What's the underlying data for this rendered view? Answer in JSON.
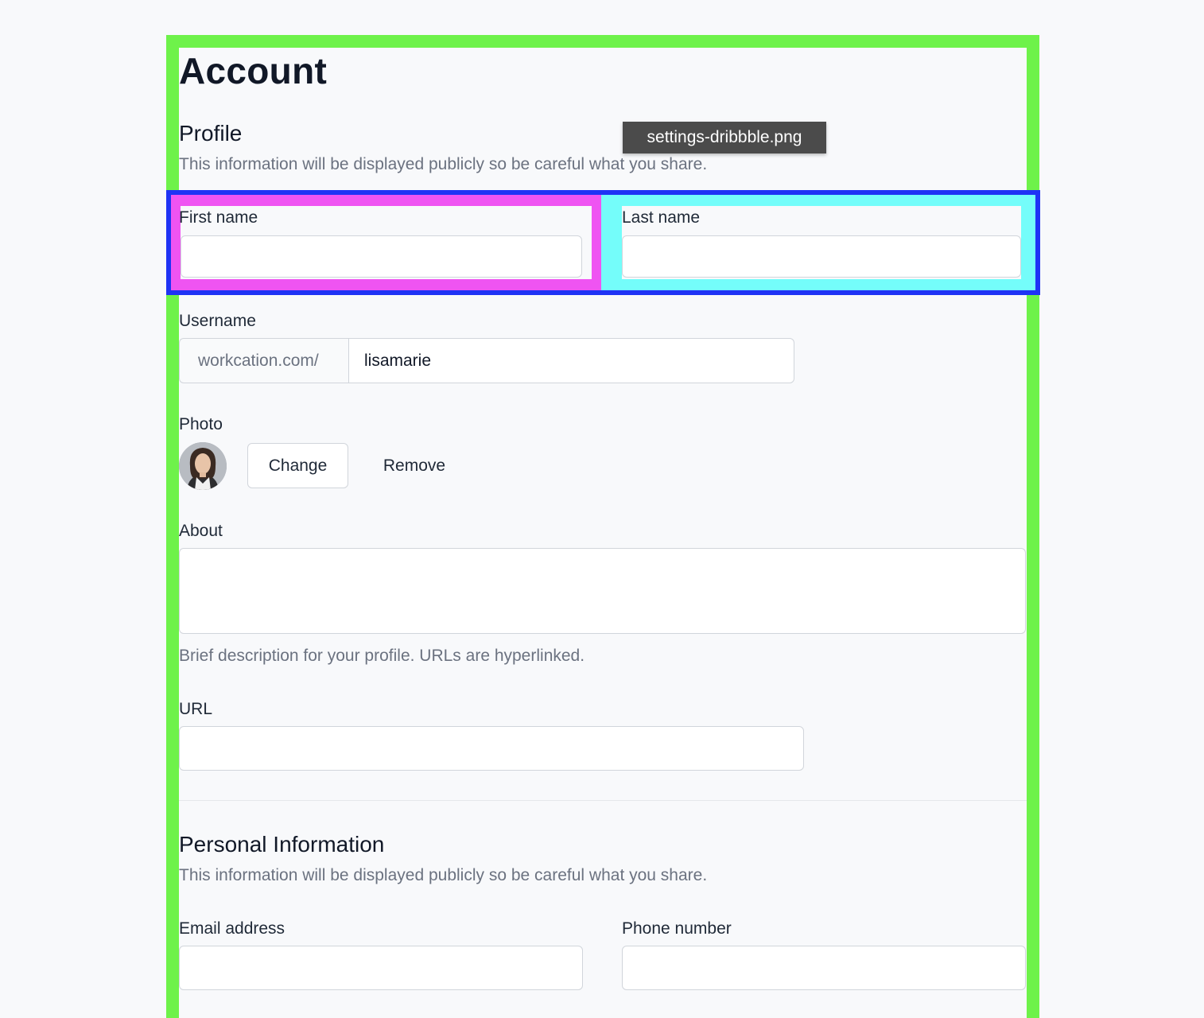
{
  "page": {
    "title": "Account"
  },
  "tooltip": {
    "text": "settings-dribbble.png"
  },
  "profile": {
    "title": "Profile",
    "description": "This information will be displayed publicly so be careful what you share.",
    "first_name": {
      "label": "First name",
      "value": ""
    },
    "last_name": {
      "label": "Last name",
      "value": ""
    },
    "username": {
      "label": "Username",
      "prefix": "workcation.com/",
      "value": "lisamarie"
    },
    "photo": {
      "label": "Photo",
      "change_label": "Change",
      "remove_label": "Remove"
    },
    "about": {
      "label": "About",
      "value": "",
      "help": "Brief description for your profile. URLs are hyperlinked."
    },
    "url": {
      "label": "URL",
      "value": ""
    }
  },
  "personal": {
    "title": "Personal Information",
    "description": "This information will be displayed publicly so be careful what you share.",
    "email": {
      "label": "Email address",
      "value": ""
    },
    "phone": {
      "label": "Phone number",
      "value": ""
    }
  },
  "colors": {
    "green_frame": "#6ef24a",
    "blue_frame": "#1f33f5",
    "magenta_frame": "#ef54f2",
    "cyan_frame": "#74fdfa"
  }
}
